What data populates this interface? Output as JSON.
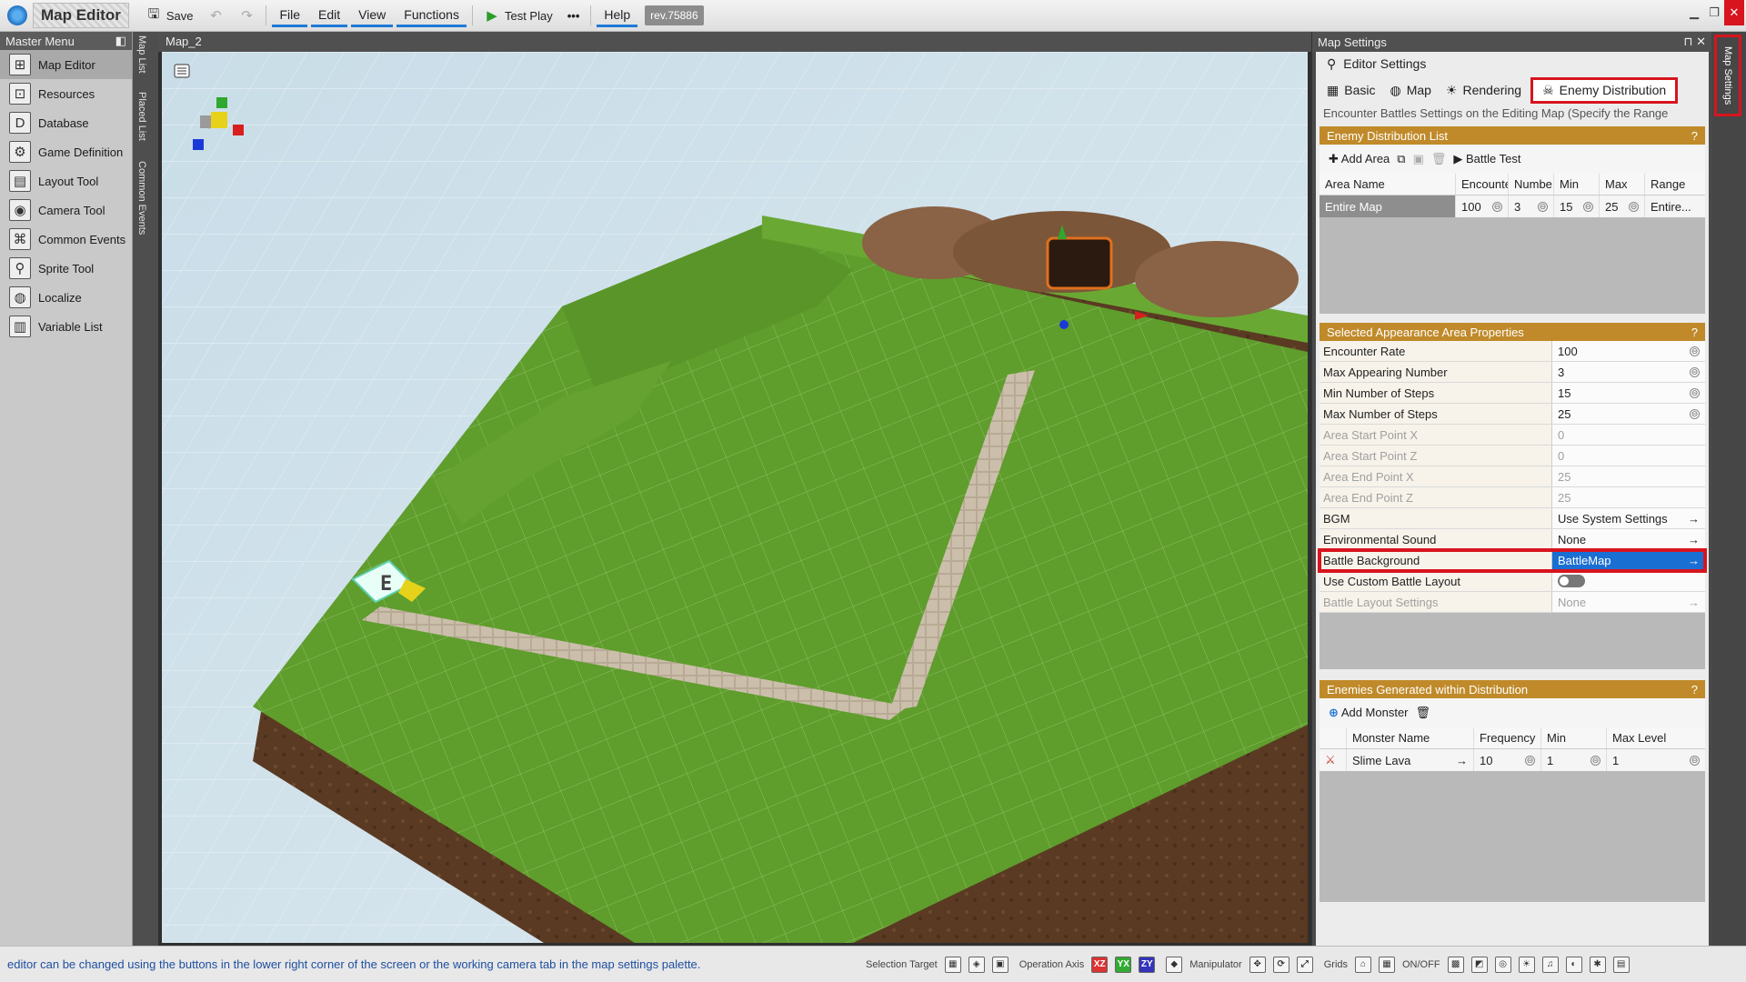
{
  "window": {
    "app_title": "Map Editor",
    "save_label": "Save",
    "menus": [
      "File",
      "Edit",
      "View",
      "Functions"
    ],
    "test_play_label": "Test Play",
    "more_label": "•••",
    "help_label": "Help",
    "revision": "rev.75886"
  },
  "master_menu": {
    "title": "Master Menu",
    "items": [
      {
        "label": "Map Editor",
        "icon": "map-editor-icon"
      },
      {
        "label": "Resources",
        "icon": "resources-icon"
      },
      {
        "label": "Database",
        "icon": "database-icon"
      },
      {
        "label": "Game Definition",
        "icon": "game-definition-icon"
      },
      {
        "label": "Layout Tool",
        "icon": "layout-tool-icon"
      },
      {
        "label": "Camera Tool",
        "icon": "camera-tool-icon"
      },
      {
        "label": "Common Events",
        "icon": "common-events-icon"
      },
      {
        "label": "Sprite Tool",
        "icon": "sprite-tool-icon"
      },
      {
        "label": "Localize",
        "icon": "localize-icon"
      },
      {
        "label": "Variable List",
        "icon": "variable-list-icon"
      }
    ]
  },
  "vertical_tabs": [
    "Map List",
    "Placed List",
    "Common Events"
  ],
  "viewport": {
    "title": "Map_2",
    "event_label": "E"
  },
  "map_settings": {
    "title": "Map Settings",
    "side_tab": "Map Settings",
    "editor_settings": "Editor Settings",
    "tabs": [
      "Basic",
      "Map",
      "Rendering",
      "Enemy Distribution"
    ],
    "description": "Encounter Battles Settings on the Editing Map (Specify the Range",
    "enemy_list": {
      "title": "Enemy Distribution List",
      "help": "?",
      "add_area": "Add Area",
      "battle_test": "Battle Test",
      "columns": [
        "Area Name",
        "Encounte",
        "Numbe",
        "Min",
        "Max",
        "Range"
      ],
      "rows": [
        [
          "Entire Map",
          "100",
          "3",
          "15",
          "25",
          "Entire..."
        ]
      ]
    },
    "properties": {
      "title": "Selected Appearance Area Properties",
      "help": "?",
      "items": [
        {
          "key": "Encounter Rate",
          "value": "100",
          "state": "edit"
        },
        {
          "key": "Max Appearing Number",
          "value": "3",
          "state": "edit"
        },
        {
          "key": "Min Number of Steps",
          "value": "15",
          "state": "edit"
        },
        {
          "key": "Max Number of Steps",
          "value": "25",
          "state": "edit"
        },
        {
          "key": "Area Start Point X",
          "value": "0",
          "state": "disabled"
        },
        {
          "key": "Area Start Point Z",
          "value": "0",
          "state": "disabled"
        },
        {
          "key": "Area End Point X",
          "value": "25",
          "state": "disabled"
        },
        {
          "key": "Area End Point Z",
          "value": "25",
          "state": "disabled"
        },
        {
          "key": "BGM",
          "value": "Use System Settings",
          "state": "link"
        },
        {
          "key": "Environmental Sound",
          "value": "None",
          "state": "link"
        },
        {
          "key": "Battle Background",
          "value": "BattleMap",
          "state": "selected"
        },
        {
          "key": "Use Custom Battle Layout",
          "value": "",
          "state": "toggle"
        },
        {
          "key": "Battle Layout Settings",
          "value": "None",
          "state": "disabled-link"
        }
      ]
    },
    "enemies": {
      "title": "Enemies Generated within Distribution",
      "help": "?",
      "add_monster": "Add Monster",
      "columns": [
        "Monster Name",
        "Frequency",
        "Min",
        "Max Level"
      ],
      "rows": [
        [
          "Slime Lava",
          "10",
          "1",
          "1"
        ]
      ]
    }
  },
  "status": {
    "message": "editor can be changed using the buttons in the lower right corner of the screen or the working camera tab in the map settings palette.",
    "selection_target": "Selection Target",
    "operation_axis": "Operation Axis",
    "axis_xz": "XZ",
    "axis_yx": "YX",
    "axis_zy": "ZY",
    "manipulator": "Manipulator",
    "grids": "Grids",
    "onoff": "ON/OFF"
  },
  "colors": {
    "accent": "#1a6fd2",
    "section": "#c08a2a",
    "highlight": "#d8141e",
    "grass": "#5e9b2c"
  }
}
